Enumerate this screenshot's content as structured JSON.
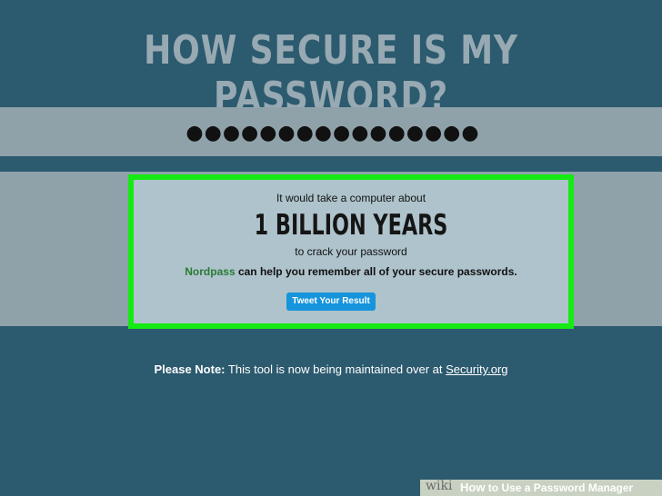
{
  "page": {
    "title": "HOW SECURE IS MY PASSWORD?"
  },
  "password": {
    "value": "●●●●●●●●●●●●●●●●"
  },
  "result": {
    "lead": "It would take a computer about",
    "time": "1 BILLION YEARS",
    "suffix": "to crack your password",
    "promo_brand": "Nordpass",
    "promo_text": " can help you remember all of your secure passwords.",
    "tweet_label": "Tweet Your Result",
    "highlight_color": "#16ea14"
  },
  "note": {
    "label": "Please Note:",
    "text": " This tool is now being maintained over at ",
    "link": "Security.org"
  },
  "watermark": {
    "wiki": "wiki",
    "how": "How",
    "rest": " to Use a Password Manager"
  }
}
